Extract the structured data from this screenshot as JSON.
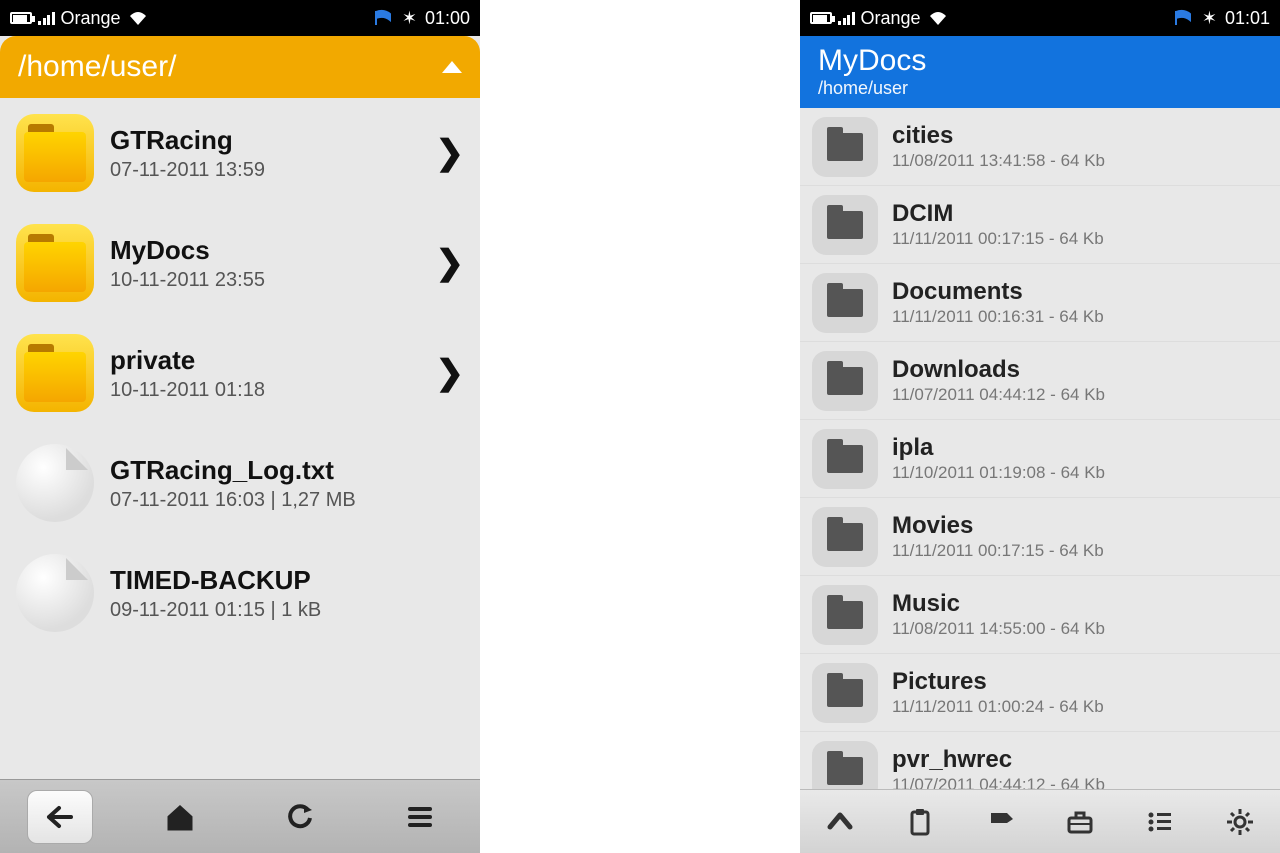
{
  "left": {
    "status": {
      "carrier": "Orange",
      "time": "01:00"
    },
    "header": {
      "path": "/home/user/"
    },
    "items": [
      {
        "type": "folder",
        "name": "GTRacing",
        "detail": "07-11-2011 13:59"
      },
      {
        "type": "folder",
        "name": "MyDocs",
        "detail": "10-11-2011 23:55"
      },
      {
        "type": "folder",
        "name": "private",
        "detail": "10-11-2011 01:18"
      },
      {
        "type": "file",
        "name": "GTRacing_Log.txt",
        "detail": "07-11-2011 16:03 | 1,27 MB"
      },
      {
        "type": "file",
        "name": "TIMED-BACKUP",
        "detail": "09-11-2011 01:15 | 1 kB"
      }
    ]
  },
  "right": {
    "status": {
      "carrier": "Orange",
      "time": "01:01"
    },
    "header": {
      "title": "MyDocs",
      "path": "/home/user"
    },
    "items": [
      {
        "name": "cities",
        "detail": "11/08/2011 13:41:58 - 64 Kb"
      },
      {
        "name": "DCIM",
        "detail": "11/11/2011 00:17:15 - 64 Kb"
      },
      {
        "name": "Documents",
        "detail": "11/11/2011 00:16:31 - 64 Kb"
      },
      {
        "name": "Downloads",
        "detail": "11/07/2011 04:44:12 - 64 Kb"
      },
      {
        "name": "ipla",
        "detail": "11/10/2011 01:19:08 - 64 Kb"
      },
      {
        "name": "Movies",
        "detail": "11/11/2011 00:17:15 - 64 Kb"
      },
      {
        "name": "Music",
        "detail": "11/08/2011 14:55:00 - 64 Kb"
      },
      {
        "name": "Pictures",
        "detail": "11/11/2011 01:00:24 - 64 Kb"
      },
      {
        "name": "pvr_hwrec",
        "detail": "11/07/2011 04:44:12 - 64 Kb"
      }
    ]
  }
}
